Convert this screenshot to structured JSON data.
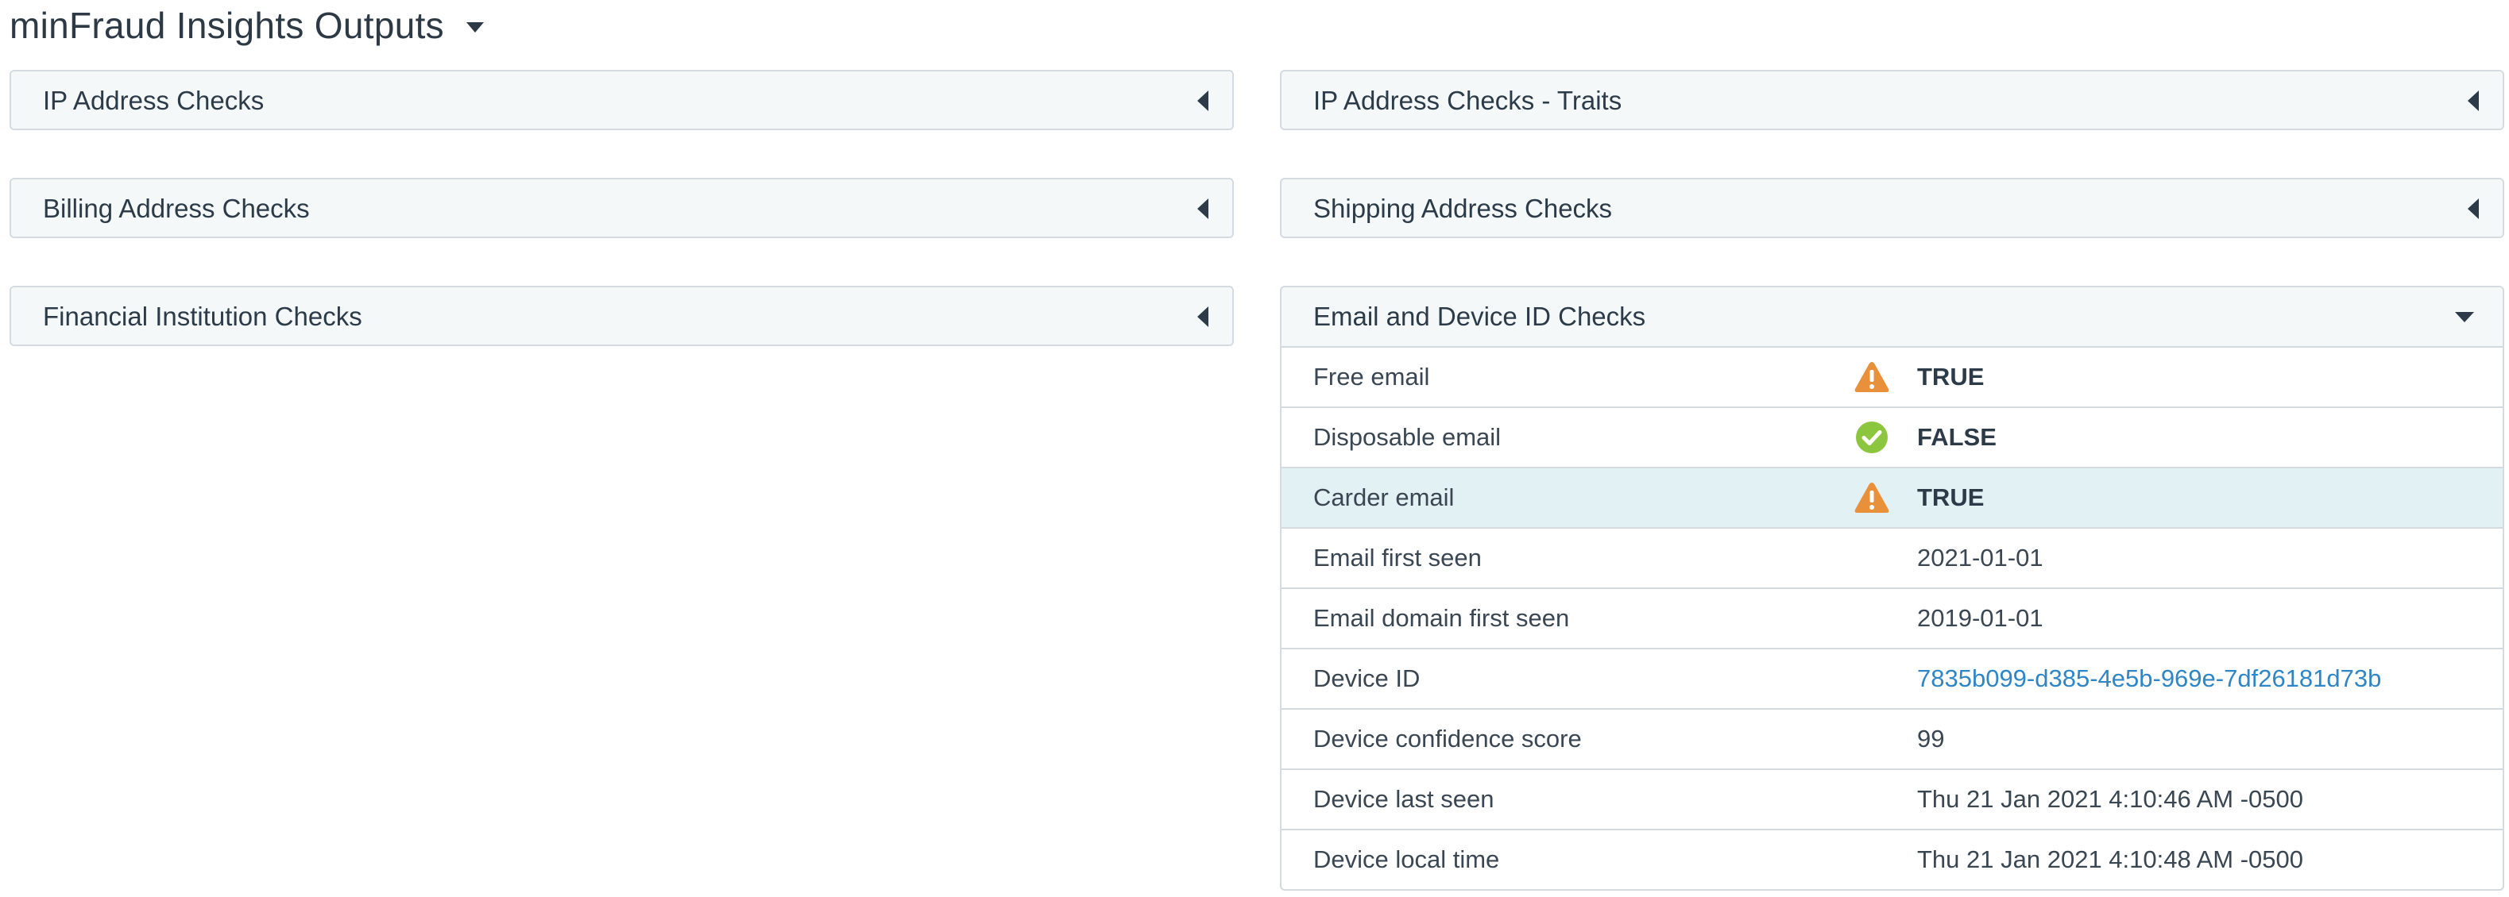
{
  "page": {
    "title": "minFraud Insights Outputs"
  },
  "panels": {
    "ip_address_checks": "IP Address Checks",
    "ip_address_traits": "IP Address Checks - Traits",
    "billing_address_checks": "Billing Address Checks",
    "shipping_address_checks": "Shipping Address Checks",
    "financial_institution_checks": "Financial Institution Checks",
    "email_device_checks": "Email and Device ID Checks"
  },
  "email_device": {
    "rows": [
      {
        "label": "Free email",
        "value": "TRUE",
        "icon": "warning-icon"
      },
      {
        "label": "Disposable email",
        "value": "FALSE",
        "icon": "check-circle-icon"
      },
      {
        "label": "Carder email",
        "value": "TRUE",
        "icon": "warning-icon",
        "highlighted": true
      },
      {
        "label": "Email first seen",
        "value": "2021-01-01"
      },
      {
        "label": "Email domain first seen",
        "value": "2019-01-01"
      },
      {
        "label": "Device ID",
        "value": "7835b099-d385-4e5b-969e-7df26181d73b",
        "link": true
      },
      {
        "label": "Device confidence score",
        "value": "99"
      },
      {
        "label": "Device last seen",
        "value": "Thu 21 Jan 2021 4:10:46 AM -0500"
      },
      {
        "label": "Device local time",
        "value": "Thu 21 Jan 2021 4:10:48 AM -0500"
      }
    ]
  },
  "colors": {
    "warning": "#e8903a",
    "success": "#8cc63f",
    "link": "#2f86c6",
    "highlight_row": "#e1f1f4",
    "header_bg": "#f4f8f9"
  }
}
